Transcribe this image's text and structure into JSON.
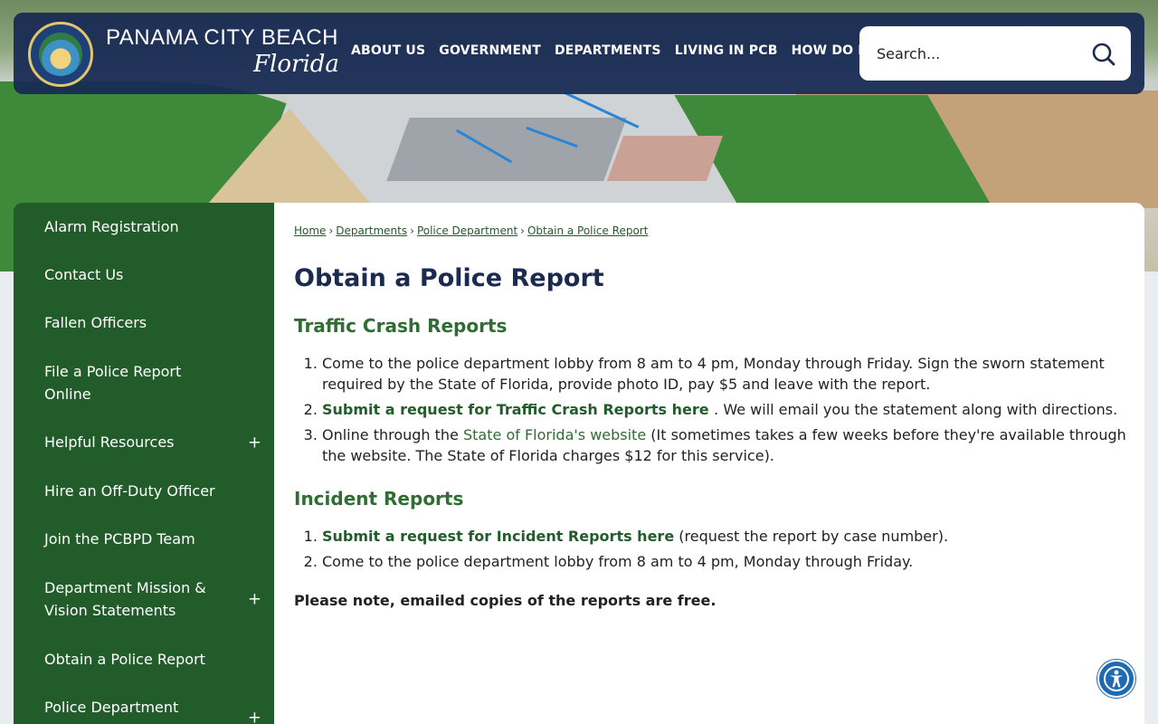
{
  "brand": {
    "name_top": "PANAMA CITY BEACH",
    "name_script": "Florida",
    "seal_alt": "Panama City Beach Florida seal"
  },
  "nav": {
    "items": [
      {
        "label": "ABOUT US"
      },
      {
        "label": "GOVERNMENT"
      },
      {
        "label": "DEPARTMENTS"
      },
      {
        "label": "LIVING IN PCB"
      },
      {
        "label": "HOW DO I..."
      }
    ]
  },
  "search": {
    "placeholder": "Search..."
  },
  "sidebar": {
    "items": [
      {
        "label": "Alarm Registration",
        "expandable": false
      },
      {
        "label": "Contact Us",
        "expandable": false
      },
      {
        "label": "Fallen Officers",
        "expandable": false
      },
      {
        "label": "File a Police Report Online",
        "expandable": false
      },
      {
        "label": "Helpful Resources",
        "expandable": true
      },
      {
        "label": "Hire an Off-Duty Officer",
        "expandable": false
      },
      {
        "label": "Join the PCBPD Team",
        "expandable": false
      },
      {
        "label": "Department Mission & Vision Statements",
        "expandable": true
      },
      {
        "label": "Obtain a Police Report",
        "expandable": false
      },
      {
        "label": "Police Department",
        "expandable": true
      }
    ],
    "expand_symbol": "+"
  },
  "breadcrumb": {
    "items": [
      "Home",
      "Departments",
      "Police Department",
      "Obtain a Police Report"
    ],
    "separator": "›"
  },
  "page": {
    "title": "Obtain a Police Report",
    "traffic": {
      "heading": "Traffic Crash Reports",
      "items": [
        {
          "text": "Come to the police department lobby from 8 am to 4 pm, Monday through Friday. Sign the sworn statement required by the State of Florida, provide photo ID, pay $5 and leave with the report."
        },
        {
          "link": "Submit a request for Traffic Crash Reports here ",
          "text": ". We will email you the statement along with directions."
        },
        {
          "pre": "Online through the ",
          "link": "State of Florida's website",
          "text": " (It sometimes takes a few weeks before they're available through the website. The State of Florida charges $12 for this service)."
        }
      ]
    },
    "incident": {
      "heading": "Incident Reports",
      "items": [
        {
          "link": "Submit a request for Incident Reports here",
          "text": " (request the report by case number)."
        },
        {
          "text": "Come to the police department lobby from 8 am to 4 pm, Monday through Friday."
        }
      ]
    },
    "note": "Please note, emailed copies of the reports are free."
  },
  "colors": {
    "header_bg": "#182b54",
    "sidebar_bg": "#235c2b",
    "heading_green": "#2f6d33",
    "title_navy": "#1b2a4e",
    "accessibility_blue": "#1f6ab0"
  },
  "icons": {
    "search": "search-icon",
    "accessibility": "accessibility-icon"
  }
}
